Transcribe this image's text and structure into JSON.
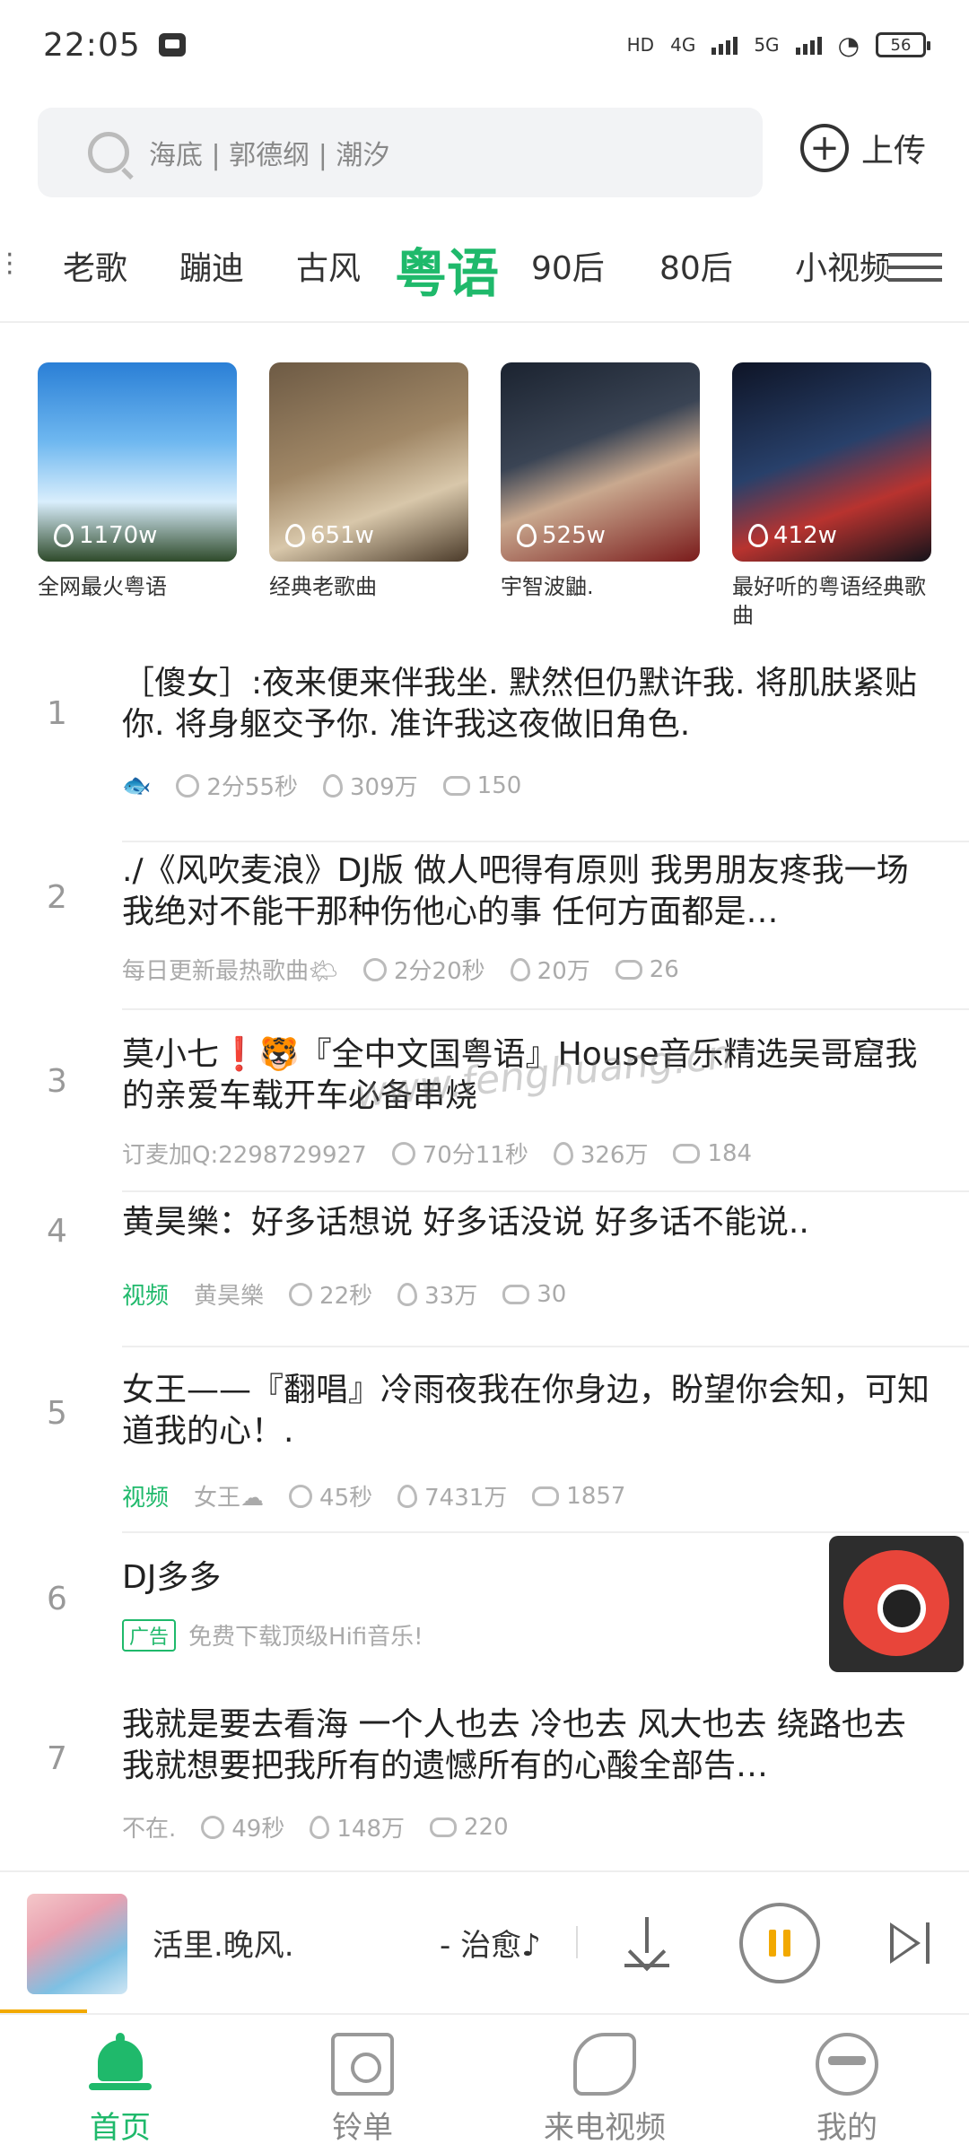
{
  "status": {
    "time": "22:05",
    "hd": "HD",
    "net1": "4G",
    "net2": "5G",
    "battery": "56"
  },
  "search": {
    "placeholder": "海底 | 郭德纲 | 潮汐",
    "upload_label": "上传"
  },
  "tabs": [
    {
      "label": "老歌",
      "active": false
    },
    {
      "label": "蹦迪",
      "active": false
    },
    {
      "label": "古风",
      "active": false
    },
    {
      "label": "粤语",
      "active": true
    },
    {
      "label": "90后",
      "active": false
    },
    {
      "label": "80后",
      "active": false
    },
    {
      "label": "小视频",
      "active": false
    }
  ],
  "playlists": [
    {
      "count": "1170w",
      "caption": "全网最火粤语"
    },
    {
      "count": "651w",
      "caption": "经典老歌曲"
    },
    {
      "count": "525w",
      "caption": "宇智波鼬."
    },
    {
      "count": "412w",
      "caption": "最好听的粤语经典歌曲"
    }
  ],
  "songs": [
    {
      "num": "1",
      "title": "［傻女］:夜来便来伴我坐. 默然但仍默许我. 将肌肤紧贴你. 将身躯交予你. 准许我这夜做旧角色.",
      "author": "🐟",
      "duration": "2分55秒",
      "plays": "309万",
      "comments": "150"
    },
    {
      "num": "2",
      "title": "./《风吹麦浪》DJ版 做人吧得有原则 我男朋友疼我一场 我绝对不能干那种伤他心的事 任何方面都是…",
      "author": "每日更新最热歌曲🌤",
      "duration": "2分20秒",
      "plays": "20万",
      "comments": "26"
    },
    {
      "num": "3",
      "title": "莫小七❗🐯『全中文国粤语』House音乐精选吴哥窟我的亲爱车载开车必备串烧",
      "author": "订麦加Q:2298729927",
      "duration": "70分11秒",
      "plays": "326万",
      "comments": "184"
    },
    {
      "num": "4",
      "title": "黄昊樂：好多话想说 好多话没说 好多话不能说..",
      "tag": "视频",
      "author": "黄昊樂",
      "duration": "22秒",
      "plays": "33万",
      "comments": "30"
    },
    {
      "num": "5",
      "title": "女王——『翻唱』冷雨夜我在你身边，盼望你会知，可知道我的心！.",
      "tag": "视频",
      "author": "女王☁",
      "duration": "45秒",
      "plays": "7431万",
      "comments": "1857"
    },
    {
      "num": "6",
      "title": "DJ多多",
      "ad_tag": "广告",
      "ad_text": "免费下载顶级Hifi音乐!"
    },
    {
      "num": "7",
      "title": "我就是要去看海  一个人也去 冷也去 风大也去 绕路也去 我就想要把我所有的遗憾所有的心酸全部告…",
      "author": "不在.",
      "duration": "49秒",
      "plays": "148万",
      "comments": "220"
    }
  ],
  "watermark": "www.fenghuang.cn",
  "player": {
    "song": "活里.晚风.",
    "tag": "- 治愈♪",
    "progress": 0.09
  },
  "nav": [
    {
      "label": "首页",
      "active": true
    },
    {
      "label": "铃单",
      "active": false
    },
    {
      "label": "来电视频",
      "active": false
    },
    {
      "label": "我的",
      "active": false
    }
  ],
  "colors": {
    "accent": "#1fb96b",
    "pause": "#f2a900"
  }
}
